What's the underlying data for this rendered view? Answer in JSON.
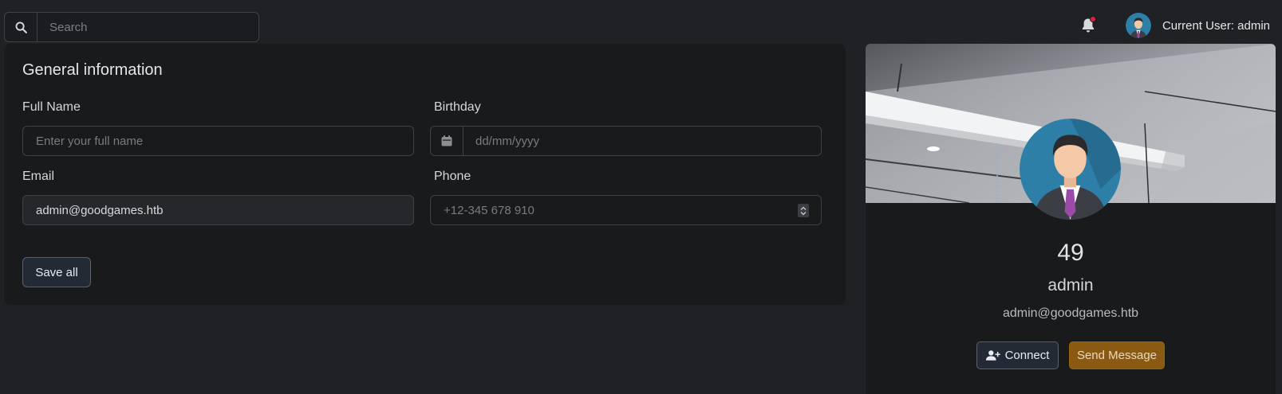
{
  "topbar": {
    "search": {
      "placeholder": "Search",
      "value": "",
      "icon": "search-icon"
    },
    "notifications": {
      "icon": "bell-icon",
      "badge_color": "#e11d48"
    },
    "user": {
      "label": "Current User: admin",
      "avatar": "user-avatar"
    }
  },
  "general_info": {
    "title": "General information",
    "full_name": {
      "label": "Full Name",
      "placeholder": "Enter your full name",
      "value": ""
    },
    "birthday": {
      "label": "Birthday",
      "placeholder": "dd/mm/yyyy",
      "value": "",
      "icon": "calendar-icon"
    },
    "email": {
      "label": "Email",
      "value": "admin@goodgames.htb"
    },
    "phone": {
      "label": "Phone",
      "placeholder": "+12-345 678 910",
      "value": ""
    },
    "save_label": "Save all"
  },
  "profile": {
    "number": "49",
    "name": "admin",
    "email": "admin@goodgames.htb",
    "connect_label": "Connect",
    "message_label": "Send Message",
    "colors": {
      "accent": "#8a5a12",
      "avatar_bg": "#2e7fa8"
    }
  }
}
